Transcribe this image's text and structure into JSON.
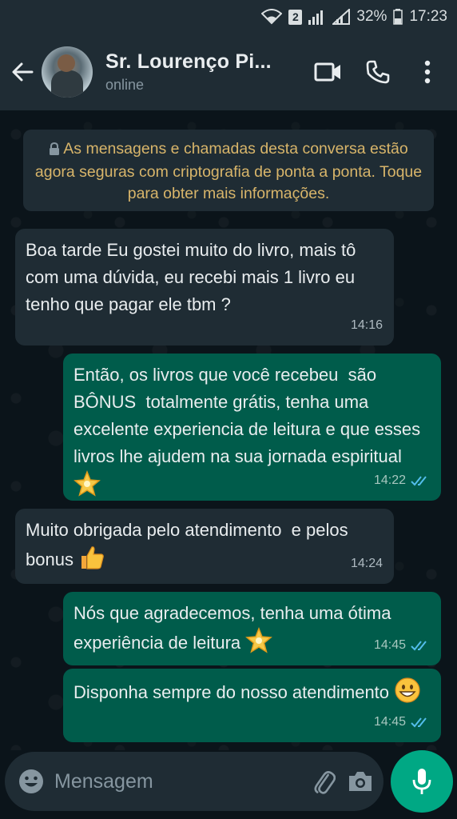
{
  "status_bar": {
    "sim_badge": "2",
    "battery": "32%",
    "time": "17:23"
  },
  "header": {
    "contact_name": "Sr. Lourenço Pi...",
    "contact_status": "online"
  },
  "notice": {
    "text": "As mensagens e chamadas desta conversa estão agora seguras com criptografia de ponta a ponta. Toque para obter mais informações."
  },
  "messages": [
    {
      "direction": "in",
      "text": "Boa tarde Eu gostei muito do livro, mais tô com uma dúvida, eu recebi mais 1 livro eu tenho que pagar ele tbm ?",
      "time": "14:16"
    },
    {
      "direction": "out",
      "text": "Então, os livros que você recebeu  são BÔNUS  totalmente grátis, tenha uma excelente experiencia de leitura e que esses livros lhe ajudem na sua jornada espiritual",
      "emoji": "glowing-star",
      "time": "14:22",
      "read": true
    },
    {
      "direction": "in",
      "text": "Muito obrigada pelo atendimento  e pelos bonus",
      "emoji": "thumbs-up",
      "time": "14:24"
    },
    {
      "direction": "out",
      "text": "Nós que agradecemos, tenha uma ótima experiência de leitura",
      "emoji": "glowing-star",
      "time": "14:45",
      "read": true
    },
    {
      "direction": "out",
      "text": "Disponha sempre do nosso atendimento",
      "emoji": "grinning-face",
      "time": "14:45",
      "read": true
    }
  ],
  "composer": {
    "placeholder": "Mensagem"
  },
  "colors": {
    "header_bg": "#1f2c34",
    "chat_bg": "#0b141a",
    "incoming_bubble": "#1f2c34",
    "outgoing_bubble": "#005c4b",
    "accent": "#00a884",
    "notice_text": "#d8b56a",
    "read_ticks": "#53bdeb"
  }
}
